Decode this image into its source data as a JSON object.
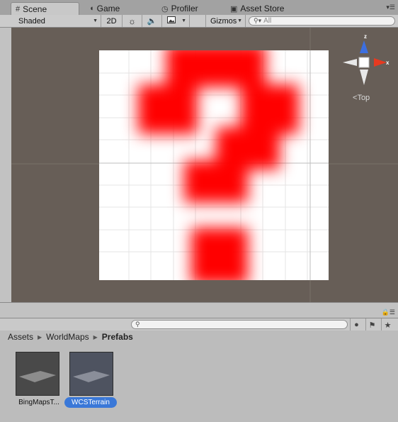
{
  "tabs": [
    {
      "label": "Scene",
      "icon": "grid-icon",
      "active": true
    },
    {
      "label": "Game",
      "icon": "pacman-icon",
      "active": false
    },
    {
      "label": "Profiler",
      "icon": "stopwatch-icon",
      "active": false
    },
    {
      "label": "Asset Store",
      "icon": "store-icon",
      "active": false
    }
  ],
  "toolbar": {
    "shading_mode": "Shaded",
    "two_d_label": "2D",
    "gizmos_label": "Gizmos",
    "search_placeholder": "All"
  },
  "scene": {
    "view_label": "Top",
    "axis_y_label": "z",
    "axis_x_label": "x",
    "texture_color": "#ff0000",
    "background_color": "#675e57"
  },
  "project": {
    "breadcrumb": [
      "Assets",
      "WorldMaps",
      "Prefabs"
    ],
    "assets": [
      {
        "name": "BingMapsT...",
        "selected": false
      },
      {
        "name": "WCSTerrain",
        "selected": true
      }
    ]
  },
  "colors": {
    "selection": "#3a78d8",
    "panel": "#c2c2c2"
  }
}
